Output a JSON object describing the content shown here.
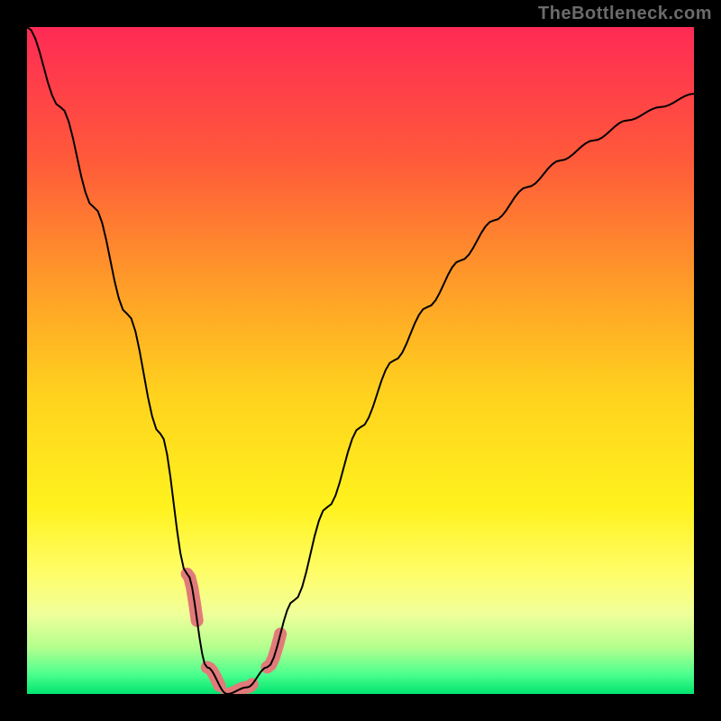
{
  "watermark": {
    "text": "TheBottleneck.com"
  },
  "gradient": {
    "stops": [
      {
        "offset": 0.0,
        "color": "#ff2a55"
      },
      {
        "offset": 0.2,
        "color": "#ff5a3a"
      },
      {
        "offset": 0.4,
        "color": "#ffa127"
      },
      {
        "offset": 0.55,
        "color": "#ffd21e"
      },
      {
        "offset": 0.72,
        "color": "#fff21e"
      },
      {
        "offset": 0.82,
        "color": "#fffe6a"
      },
      {
        "offset": 0.88,
        "color": "#f0ff9a"
      },
      {
        "offset": 0.93,
        "color": "#b4ff8e"
      },
      {
        "offset": 0.97,
        "color": "#4dff8e"
      },
      {
        "offset": 1.0,
        "color": "#00e56e"
      }
    ]
  },
  "curve": {
    "stroke": "#000000",
    "width": 2,
    "highlight_color": "#e27a7a",
    "highlight_width": 14,
    "highlight_regions": [
      {
        "t_start": 0.24,
        "t_end": 0.258
      },
      {
        "t_start": 0.27,
        "t_end": 0.29
      },
      {
        "t_start": 0.3,
        "t_end": 0.34
      },
      {
        "t_start": 0.36,
        "t_end": 0.38
      }
    ]
  },
  "chart_data": {
    "type": "line",
    "title": "",
    "xlabel": "",
    "ylabel": "",
    "xlim": [
      0,
      1
    ],
    "ylim": [
      0,
      1
    ],
    "grid": false,
    "legend": false,
    "notes": "A bottleneck-style V curve on a rainbow vertical gradient. y represents mismatch (0 = ideal at trough, 1 = worst at top). Minimum occurs near x ≈ 0.30. Highlighted pink segments mark the near-optimal region around the trough.",
    "x": [
      0.0,
      0.05,
      0.1,
      0.15,
      0.2,
      0.24,
      0.27,
      0.3,
      0.33,
      0.36,
      0.4,
      0.45,
      0.5,
      0.55,
      0.6,
      0.65,
      0.7,
      0.75,
      0.8,
      0.85,
      0.9,
      0.95,
      1.0
    ],
    "y": [
      1.0,
      0.88,
      0.73,
      0.57,
      0.39,
      0.18,
      0.04,
      0.0,
      0.01,
      0.04,
      0.14,
      0.28,
      0.4,
      0.5,
      0.58,
      0.65,
      0.71,
      0.76,
      0.8,
      0.83,
      0.86,
      0.88,
      0.9
    ],
    "highlight_x_range": [
      0.24,
      0.38
    ],
    "colors": {
      "curve": "#000000",
      "highlight": "#e27a7a"
    }
  }
}
